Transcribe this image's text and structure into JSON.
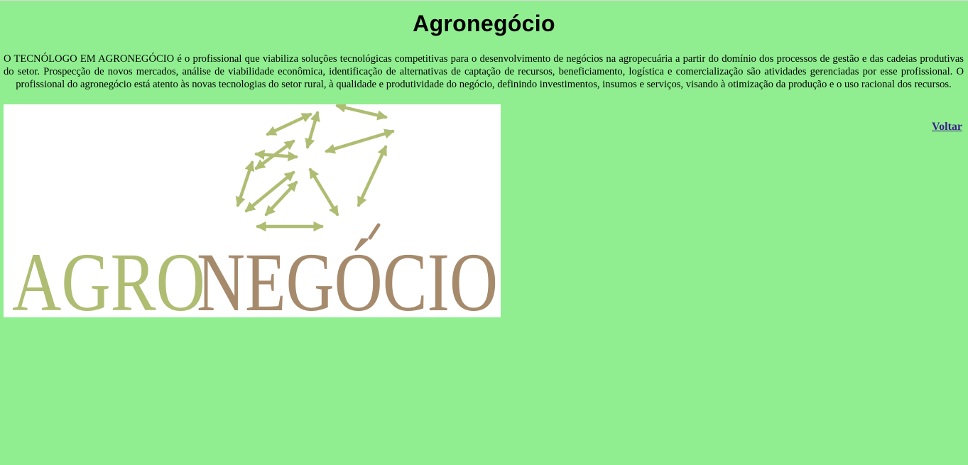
{
  "page": {
    "title": "Agronegócio",
    "description": "O TECNÓLOGO EM AGRONEGÓCIO é o profissional que viabiliza soluções tecnológicas competitivas para o desenvolvimento de negócios na agropecuária a partir do domínio dos processos de gestão e das cadeias produtivas do setor. Prospecção de novos mercados, análise de viabilidade econômica, identificação de alternativas de captação de recursos, beneficiamento, logística e comercialização são atividades gerenciadas por esse profissional. O profissional do agronegócio está atento às novas tecnologias do setor rural, à qualidade e produtividade do negócio, definindo investimentos, insumos e serviços, visando à otimização da produção e o uso racional dos recursos.",
    "back_link": "Voltar"
  },
  "logo": {
    "icon": "agronegocio-logo",
    "text_part1": "AGRO",
    "text_part2": "NEGÓCIO",
    "color_green": "#aebd72",
    "color_brown": "#a68a6c"
  },
  "colors": {
    "background": "#90EE90",
    "link": "#3a1f8a"
  }
}
